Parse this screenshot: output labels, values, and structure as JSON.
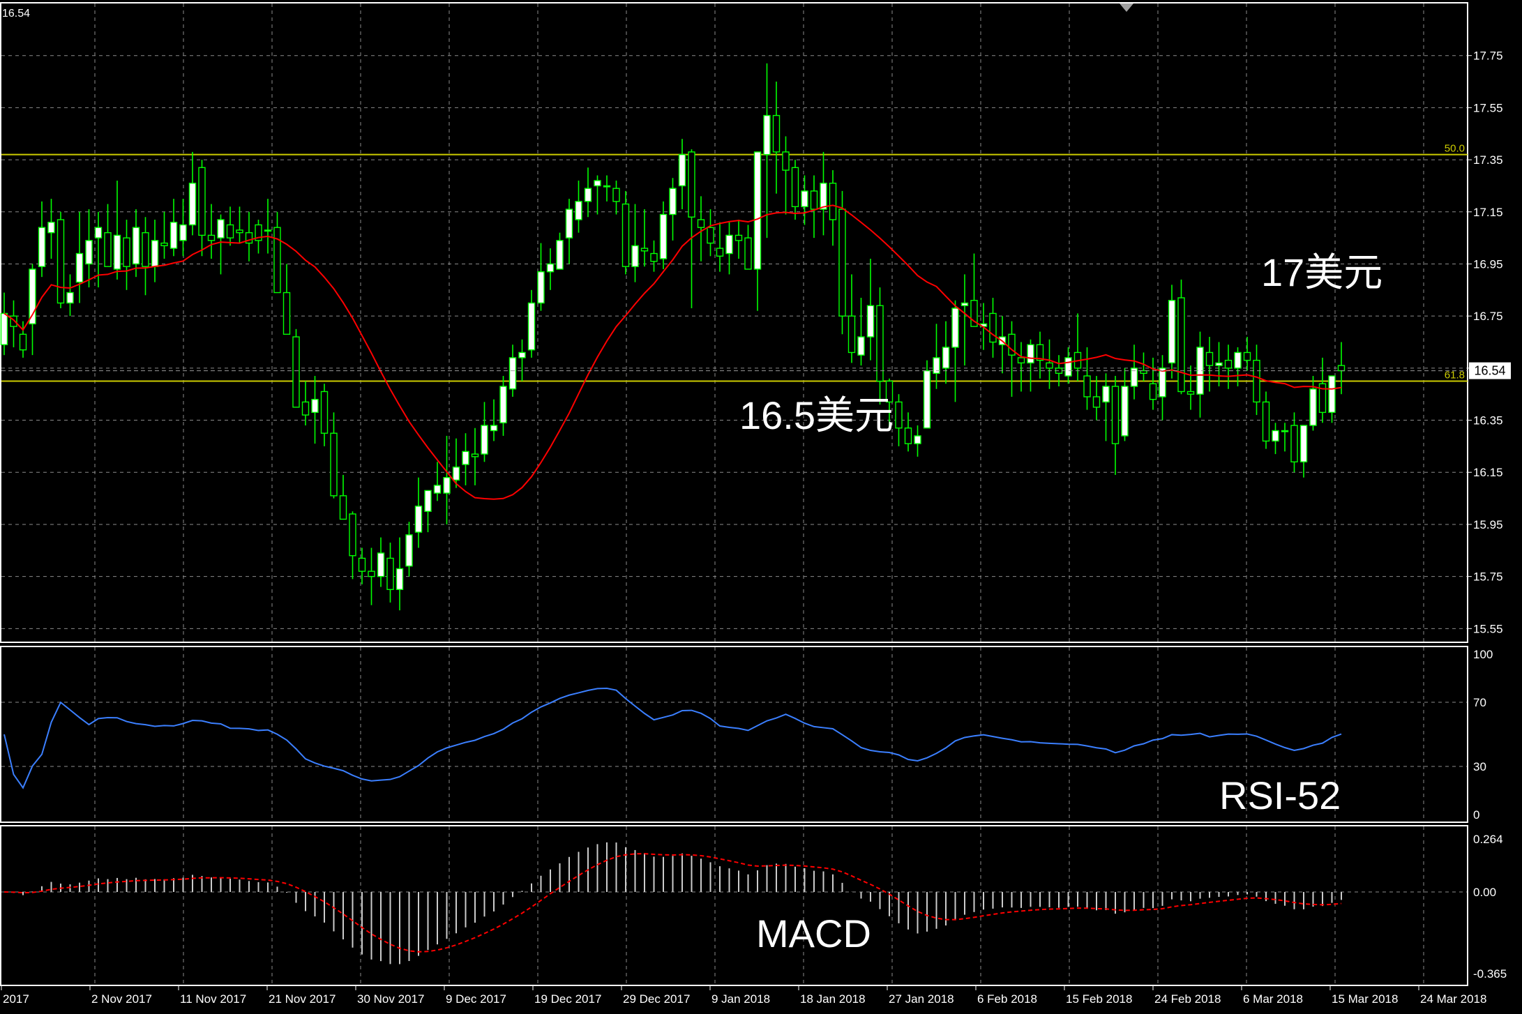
{
  "chart_data": {
    "type": "candlestick",
    "instrument_price_label": "16.54",
    "x_tick_labels": [
      "2017",
      "2 Nov 2017",
      "11 Nov 2017",
      "21 Nov 2017",
      "30 Nov 2017",
      "9 Dec 2017",
      "19 Dec 2017",
      "29 Dec 2017",
      "9 Jan 2018",
      "18 Jan 2018",
      "27 Jan 2018",
      "6 Feb 2018",
      "15 Feb 2018",
      "24 Feb 2018",
      "6 Mar 2018",
      "15 Mar 2018",
      "24 Mar 2018"
    ],
    "price_panel": {
      "ylim": [
        15.5,
        17.95
      ],
      "y_ticks": [
        "17.75",
        "17.55",
        "17.35",
        "17.15",
        "16.95",
        "16.75",
        "16.55",
        "16.35",
        "16.15",
        "15.95",
        "15.75",
        "15.55"
      ],
      "current_price": 16.54,
      "current_price_label": "16.54",
      "fib_levels": [
        {
          "label": "50.0",
          "value": 17.37
        },
        {
          "label": "61.8",
          "value": 16.5
        }
      ],
      "annotations": [
        {
          "text": "17美元",
          "color": "#ffffff"
        },
        {
          "text": "16.5美元",
          "color": "#ffffff"
        }
      ],
      "candles_ohlc": [
        [
          16.64,
          16.84,
          16.6,
          16.76
        ],
        [
          16.75,
          16.81,
          16.63,
          16.71
        ],
        [
          16.68,
          16.73,
          16.59,
          16.62
        ],
        [
          16.72,
          16.95,
          16.6,
          16.93
        ],
        [
          16.94,
          17.19,
          16.9,
          17.09
        ],
        [
          17.07,
          17.2,
          16.97,
          17.11
        ],
        [
          17.12,
          17.15,
          16.78,
          16.8
        ],
        [
          16.8,
          16.91,
          16.75,
          16.84
        ],
        [
          16.88,
          17.15,
          16.8,
          16.99
        ],
        [
          16.95,
          17.16,
          16.86,
          17.04
        ],
        [
          17.05,
          17.15,
          16.86,
          17.09
        ],
        [
          17.07,
          17.18,
          16.96,
          16.94
        ],
        [
          16.93,
          17.27,
          16.89,
          17.06
        ],
        [
          17.05,
          17.12,
          16.85,
          16.94
        ],
        [
          16.95,
          17.16,
          16.9,
          17.09
        ],
        [
          17.07,
          17.13,
          16.83,
          16.94
        ],
        [
          16.94,
          17.12,
          16.88,
          17.04
        ],
        [
          17.03,
          17.15,
          16.97,
          17.02
        ],
        [
          17.01,
          17.2,
          16.98,
          17.11
        ],
        [
          17.04,
          17.2,
          16.98,
          17.1
        ],
        [
          17.1,
          17.38,
          17.06,
          17.26
        ],
        [
          17.32,
          17.35,
          16.98,
          17.06
        ],
        [
          17.06,
          17.18,
          16.97,
          17.04
        ],
        [
          17.05,
          17.14,
          16.91,
          17.12
        ],
        [
          17.1,
          17.17,
          17.02,
          17.05
        ],
        [
          17.08,
          17.17,
          17.03,
          17.07
        ],
        [
          17.07,
          17.15,
          16.96,
          17.03
        ],
        [
          17.1,
          17.12,
          16.99,
          17.04
        ],
        [
          17.08,
          17.2,
          16.99,
          17.08
        ],
        [
          17.09,
          17.15,
          16.89,
          16.84
        ],
        [
          16.84,
          16.95,
          16.71,
          16.68
        ],
        [
          16.67,
          16.7,
          16.41,
          16.4
        ],
        [
          16.42,
          16.5,
          16.33,
          16.37
        ],
        [
          16.38,
          16.52,
          16.26,
          16.43
        ],
        [
          16.46,
          16.49,
          16.25,
          16.3
        ],
        [
          16.3,
          16.38,
          16.05,
          16.06
        ],
        [
          16.06,
          16.14,
          15.97,
          15.97
        ],
        [
          15.99,
          16.0,
          15.74,
          15.83
        ],
        [
          15.82,
          15.86,
          15.72,
          15.77
        ],
        [
          15.77,
          15.86,
          15.64,
          15.75
        ],
        [
          15.75,
          15.9,
          15.71,
          15.84
        ],
        [
          15.82,
          15.88,
          15.65,
          15.7
        ],
        [
          15.7,
          15.9,
          15.62,
          15.78
        ],
        [
          15.79,
          15.96,
          15.75,
          15.91
        ],
        [
          15.92,
          16.13,
          15.86,
          16.02
        ],
        [
          16.0,
          16.08,
          15.92,
          16.08
        ],
        [
          16.07,
          16.19,
          16.04,
          16.1
        ],
        [
          16.07,
          16.29,
          15.95,
          16.13
        ],
        [
          16.12,
          16.28,
          16.09,
          16.17
        ],
        [
          16.18,
          16.3,
          16.1,
          16.23
        ],
        [
          16.22,
          16.32,
          16.1,
          16.21
        ],
        [
          16.22,
          16.42,
          16.19,
          16.33
        ],
        [
          16.31,
          16.43,
          16.27,
          16.33
        ],
        [
          16.34,
          16.52,
          16.29,
          16.48
        ],
        [
          16.47,
          16.64,
          16.44,
          16.59
        ],
        [
          16.59,
          16.66,
          16.5,
          16.61
        ],
        [
          16.62,
          16.85,
          16.59,
          16.8
        ],
        [
          16.8,
          17.03,
          16.77,
          16.92
        ],
        [
          16.92,
          17.01,
          16.85,
          16.95
        ],
        [
          16.93,
          17.07,
          16.93,
          17.04
        ],
        [
          17.05,
          17.2,
          16.95,
          17.16
        ],
        [
          17.12,
          17.27,
          17.07,
          17.19
        ],
        [
          17.19,
          17.32,
          17.13,
          17.24
        ],
        [
          17.25,
          17.29,
          17.14,
          17.27
        ],
        [
          17.25,
          17.29,
          17.19,
          17.25
        ],
        [
          17.24,
          17.27,
          17.14,
          17.19
        ],
        [
          17.18,
          17.23,
          16.91,
          16.94
        ],
        [
          16.94,
          17.18,
          16.88,
          17.02
        ],
        [
          17.01,
          17.16,
          16.94,
          17.0
        ],
        [
          16.99,
          17.04,
          16.92,
          16.96
        ],
        [
          16.97,
          17.19,
          16.93,
          17.14
        ],
        [
          17.14,
          17.28,
          17.04,
          17.24
        ],
        [
          17.25,
          17.43,
          17.16,
          17.37
        ],
        [
          17.38,
          17.39,
          16.78,
          17.13
        ],
        [
          17.12,
          17.21,
          16.96,
          17.09
        ],
        [
          17.09,
          17.16,
          16.98,
          17.03
        ],
        [
          17.01,
          17.11,
          16.92,
          16.98
        ],
        [
          16.99,
          17.11,
          16.91,
          17.06
        ],
        [
          17.06,
          17.12,
          16.97,
          17.04
        ],
        [
          17.05,
          17.1,
          16.96,
          16.93
        ],
        [
          16.93,
          17.26,
          16.77,
          17.38
        ],
        [
          17.37,
          17.72,
          17.05,
          17.52
        ],
        [
          17.52,
          17.65,
          17.22,
          17.38
        ],
        [
          17.38,
          17.44,
          17.14,
          17.31
        ],
        [
          17.32,
          17.35,
          17.12,
          17.17
        ],
        [
          17.17,
          17.29,
          17.1,
          17.23
        ],
        [
          17.23,
          17.29,
          17.05,
          17.16
        ],
        [
          17.16,
          17.38,
          17.06,
          17.26
        ],
        [
          17.26,
          17.31,
          17.02,
          17.12
        ],
        [
          17.16,
          17.23,
          16.68,
          16.75
        ],
        [
          16.75,
          16.91,
          16.57,
          16.61
        ],
        [
          16.6,
          16.82,
          16.56,
          16.67
        ],
        [
          16.67,
          16.97,
          16.58,
          16.79
        ],
        [
          16.79,
          16.86,
          16.41,
          16.5
        ],
        [
          16.5,
          16.51,
          16.31,
          16.42
        ],
        [
          16.42,
          16.45,
          16.25,
          16.32
        ],
        [
          16.32,
          16.38,
          16.23,
          16.26
        ],
        [
          16.26,
          16.33,
          16.21,
          16.29
        ],
        [
          16.32,
          16.58,
          16.33,
          16.54
        ],
        [
          16.53,
          16.72,
          16.47,
          16.59
        ],
        [
          16.55,
          16.73,
          16.49,
          16.63
        ],
        [
          16.63,
          16.81,
          16.42,
          16.78
        ],
        [
          16.79,
          16.91,
          16.56,
          16.8
        ],
        [
          16.81,
          16.99,
          16.73,
          16.71
        ],
        [
          16.71,
          16.8,
          16.62,
          16.72
        ],
        [
          16.76,
          16.82,
          16.59,
          16.65
        ],
        [
          16.64,
          16.75,
          16.53,
          16.67
        ],
        [
          16.68,
          16.73,
          16.44,
          16.6
        ],
        [
          16.59,
          16.65,
          16.46,
          16.57
        ],
        [
          16.57,
          16.66,
          16.46,
          16.64
        ],
        [
          16.64,
          16.69,
          16.51,
          16.58
        ],
        [
          16.57,
          16.66,
          16.47,
          16.55
        ],
        [
          16.55,
          16.6,
          16.48,
          16.53
        ],
        [
          16.52,
          16.63,
          16.49,
          16.59
        ],
        [
          16.61,
          16.76,
          16.5,
          16.55
        ],
        [
          16.52,
          16.63,
          16.39,
          16.44
        ],
        [
          16.44,
          16.52,
          16.35,
          16.4
        ],
        [
          16.42,
          16.53,
          16.27,
          16.48
        ],
        [
          16.48,
          16.52,
          16.14,
          16.26
        ],
        [
          16.29,
          16.55,
          16.27,
          16.48
        ],
        [
          16.48,
          16.64,
          16.43,
          16.55
        ],
        [
          16.54,
          16.61,
          16.5,
          16.53
        ],
        [
          16.49,
          16.59,
          16.39,
          16.43
        ],
        [
          16.44,
          16.6,
          16.35,
          16.55
        ],
        [
          16.57,
          16.87,
          16.51,
          16.81
        ],
        [
          16.82,
          16.89,
          16.45,
          16.46
        ],
        [
          16.46,
          16.56,
          16.39,
          16.45
        ],
        [
          16.45,
          16.69,
          16.36,
          16.63
        ],
        [
          16.61,
          16.67,
          16.46,
          16.56
        ],
        [
          16.56,
          16.65,
          16.48,
          16.57
        ],
        [
          16.58,
          16.64,
          16.47,
          16.55
        ],
        [
          16.55,
          16.63,
          16.48,
          16.61
        ],
        [
          16.61,
          16.67,
          16.54,
          16.58
        ],
        [
          16.58,
          16.64,
          16.37,
          16.42
        ],
        [
          16.42,
          16.46,
          16.24,
          16.27
        ],
        [
          16.27,
          16.34,
          16.22,
          16.31
        ],
        [
          16.31,
          16.34,
          16.23,
          16.31
        ],
        [
          16.33,
          16.38,
          16.15,
          16.19
        ],
        [
          16.19,
          16.31,
          16.13,
          16.33
        ],
        [
          16.33,
          16.52,
          16.31,
          16.47
        ],
        [
          16.49,
          16.59,
          16.34,
          16.38
        ],
        [
          16.38,
          16.49,
          16.34,
          16.52
        ],
        [
          16.56,
          16.65,
          16.45,
          16.54
        ]
      ]
    },
    "rsi_panel": {
      "label": "RSI-52",
      "ylim": [
        0,
        100
      ],
      "y_ticks": [
        "100",
        "70",
        "30",
        "0"
      ]
    },
    "macd_panel": {
      "label": "MACD",
      "ylim": [
        -0.365,
        0.264
      ],
      "y_ticks": [
        "0.264",
        "0.00",
        "-0.365"
      ]
    },
    "colors": {
      "background": "#000000",
      "frame": "#ffffff",
      "grid": "#8c8c8c",
      "bull": "#ffffff",
      "bear": "#000000",
      "wick": "#00ff00",
      "moving_average": "#ff0000",
      "fib_line": "#cccc00",
      "rsi_line": "#3b7fff",
      "macd_hist": "#cccccc",
      "macd_signal": "#ff0000",
      "label_text": "#ffffff",
      "price_box_bg": "#ffffff",
      "price_box_text": "#000000"
    }
  }
}
